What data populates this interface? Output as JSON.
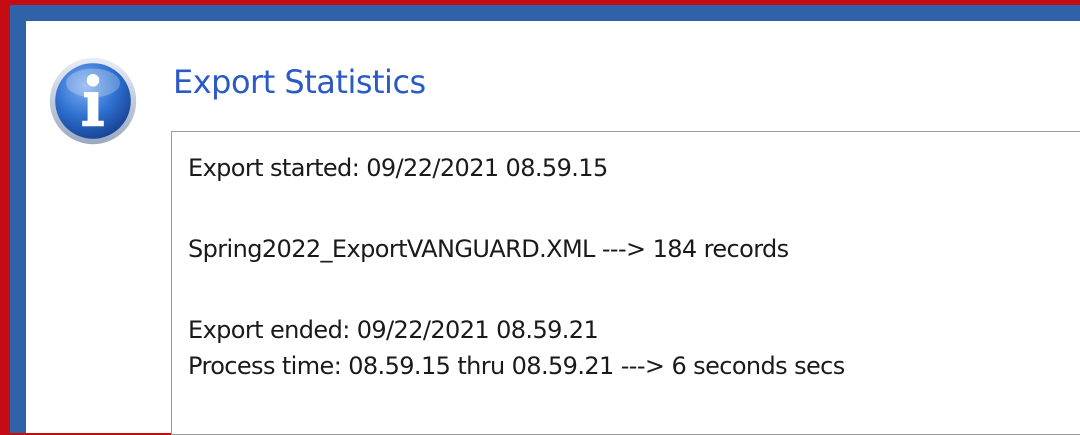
{
  "dialog": {
    "title": "Export Statistics",
    "icon": "info-icon",
    "accent_color": "#2a5ac4",
    "frame_color": "#c40c12"
  },
  "stats": {
    "started": "Export started: 09/22/2021 08.59.15",
    "file_summary": "Spring2022_ExportVANGUARD.XML ---> 184 records",
    "ended": "Export ended: 09/22/2021 08.59.21",
    "process_time": "Process time: 08.59.15 thru 08.59.21 ---> 6 seconds secs"
  }
}
